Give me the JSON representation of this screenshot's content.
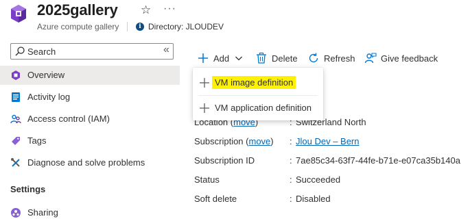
{
  "header": {
    "title": "2025gallery",
    "subtitle": "Azure compute gallery",
    "directory": "Directory: JLOUDEV",
    "more_label": "···"
  },
  "sidebar": {
    "search_placeholder": "Search",
    "collapse_label": "«",
    "items": [
      {
        "label": "Overview",
        "icon": "overview-icon"
      },
      {
        "label": "Activity log",
        "icon": "activity-log-icon"
      },
      {
        "label": "Access control (IAM)",
        "icon": "people-icon"
      },
      {
        "label": "Tags",
        "icon": "tag-icon"
      },
      {
        "label": "Diagnose and solve problems",
        "icon": "wrench-icon"
      }
    ],
    "section_settings": "Settings",
    "settings_items": [
      {
        "label": "Sharing",
        "icon": "sharing-icon"
      }
    ]
  },
  "toolbar": {
    "add": "Add",
    "delete": "Delete",
    "refresh": "Refresh",
    "feedback": "Give feedback"
  },
  "dropdown": {
    "items": [
      {
        "label": "VM image definition",
        "highlighted": true
      },
      {
        "label": "VM application definition",
        "highlighted": false
      }
    ]
  },
  "properties": {
    "location_label": "Location",
    "location_move": "move",
    "location_value": "Switzerland North",
    "subscription_label": "Subscription",
    "subscription_move": "move",
    "subscription_value": "Jlou Dev – Bern",
    "subscription_id_label": "Subscription ID",
    "subscription_id_value": "7ae85c34-63f7-44fe-b71e-e07ca35b140a",
    "status_label": "Status",
    "status_value": "Succeeded",
    "soft_delete_label": "Soft delete",
    "soft_delete_value": "Disabled"
  },
  "colors": {
    "accent": "#0067b8",
    "highlight": "#fff200",
    "selected_bg": "#edebe9"
  }
}
